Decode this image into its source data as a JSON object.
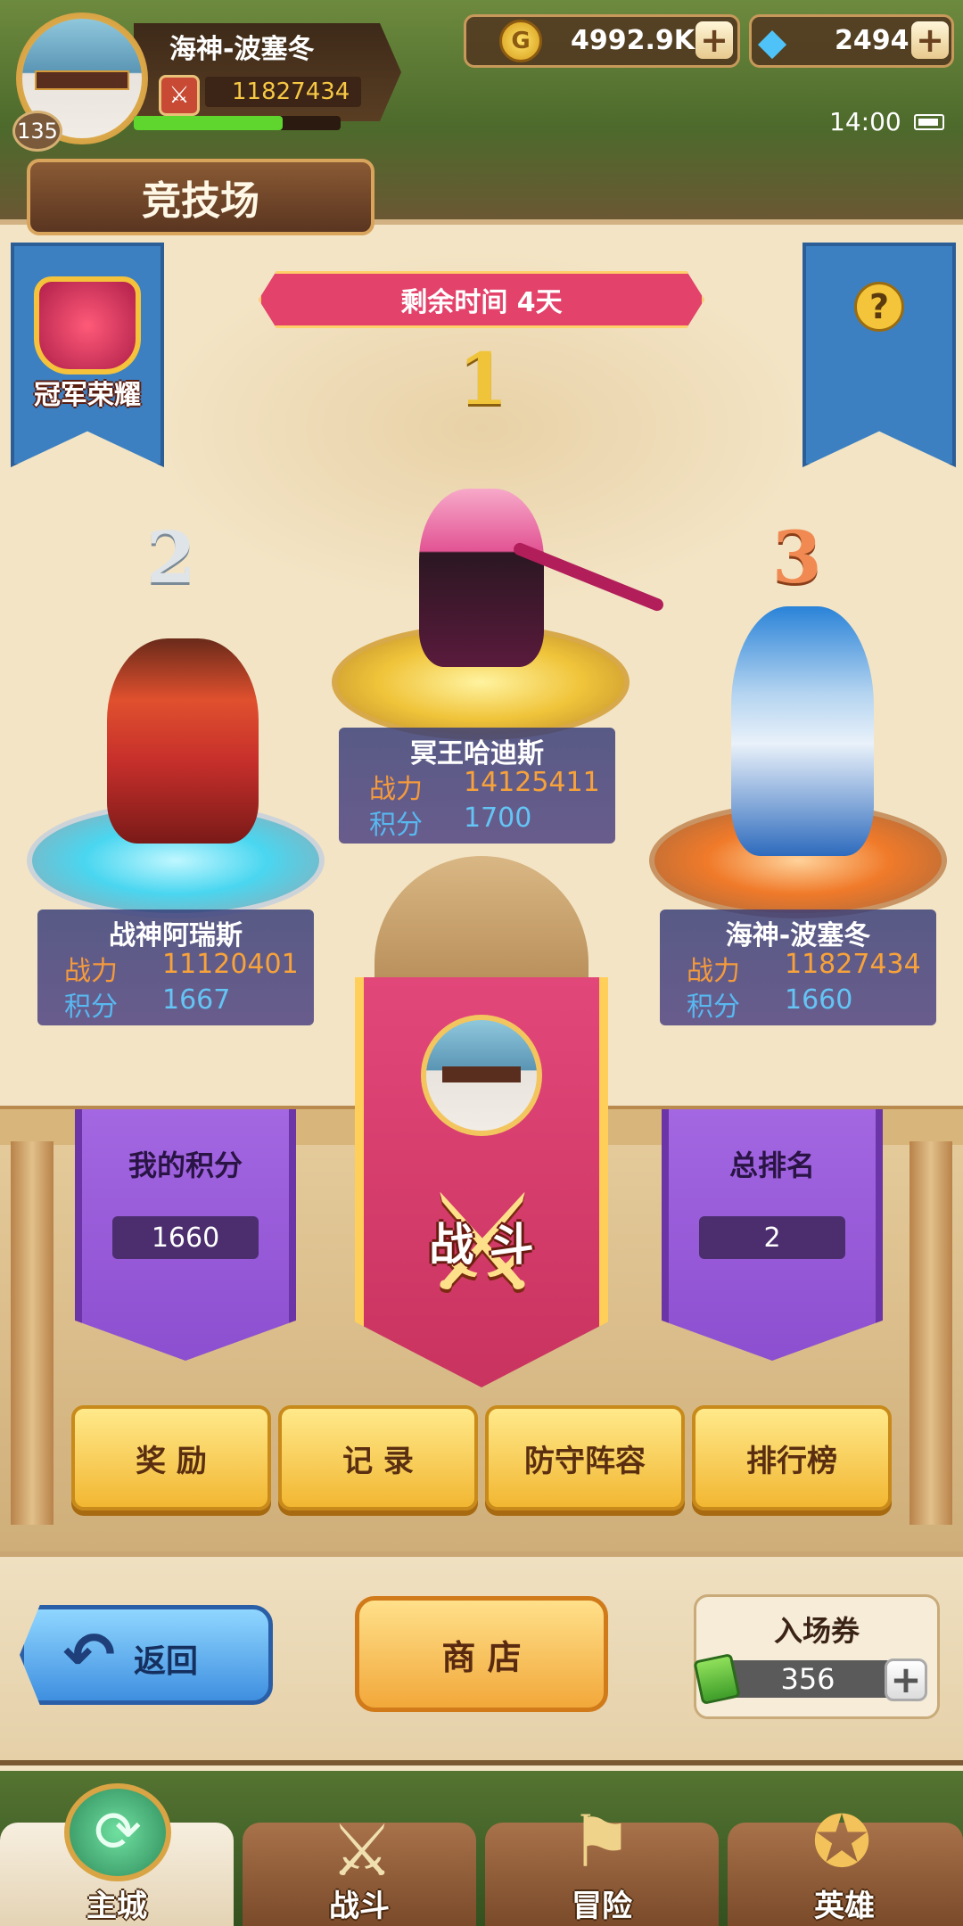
{
  "player": {
    "name": "海神-波塞冬",
    "level": "135",
    "power": "11827434",
    "hp_fraction": 0.72
  },
  "currency": {
    "gold": "4992.9K",
    "gems": "2494",
    "plus": "+"
  },
  "status": {
    "time": "14:00"
  },
  "page": {
    "title": "竞技场"
  },
  "banners": {
    "honor_label": "冠军荣耀",
    "help_icon": "?"
  },
  "season": {
    "remaining": "剩余时间 4天"
  },
  "podium": [
    {
      "rank": "1",
      "name": "冥王哈迪斯",
      "power_label": "战力",
      "power": "14125411",
      "score_label": "积分",
      "score": "1700"
    },
    {
      "rank": "2",
      "name": "战神阿瑞斯",
      "power_label": "战力",
      "power": "11120401",
      "score_label": "积分",
      "score": "1667"
    },
    {
      "rank": "3",
      "name": "海神-波塞冬",
      "power_label": "战力",
      "power": "11827434",
      "score_label": "积分",
      "score": "1660"
    }
  ],
  "my_stats": {
    "score_label": "我的积分",
    "score": "1660",
    "rank_label": "总排名",
    "rank": "2"
  },
  "fight": {
    "label": "战 斗"
  },
  "actions": {
    "reward": "奖 励",
    "record": "记 录",
    "defense": "防守阵容",
    "leaderboard": "排行榜"
  },
  "footer": {
    "back": "返回",
    "shop": "商 店",
    "ticket_label": "入场券",
    "ticket_count": "356",
    "ticket_plus": "+"
  },
  "nav": {
    "home": "主城",
    "battle": "战斗",
    "adventure": "冒险",
    "hero": "英雄"
  },
  "colors": {
    "gold_accent": "#f2b732",
    "fight_banner": "#d93d6c",
    "side_banner": "#3c80c1",
    "purple_banner": "#9a5cdc"
  },
  "icons": [
    "avatar",
    "crossed-swords-icon",
    "gold-coin-icon",
    "diamond-icon",
    "plus-icon",
    "battery-icon",
    "trophy-crown-icon",
    "help-icon",
    "back-arrow-icon",
    "ticket-icon",
    "home-castle-icon",
    "battle-swords-icon",
    "adventure-scroll-icon",
    "hero-emblem-icon"
  ]
}
